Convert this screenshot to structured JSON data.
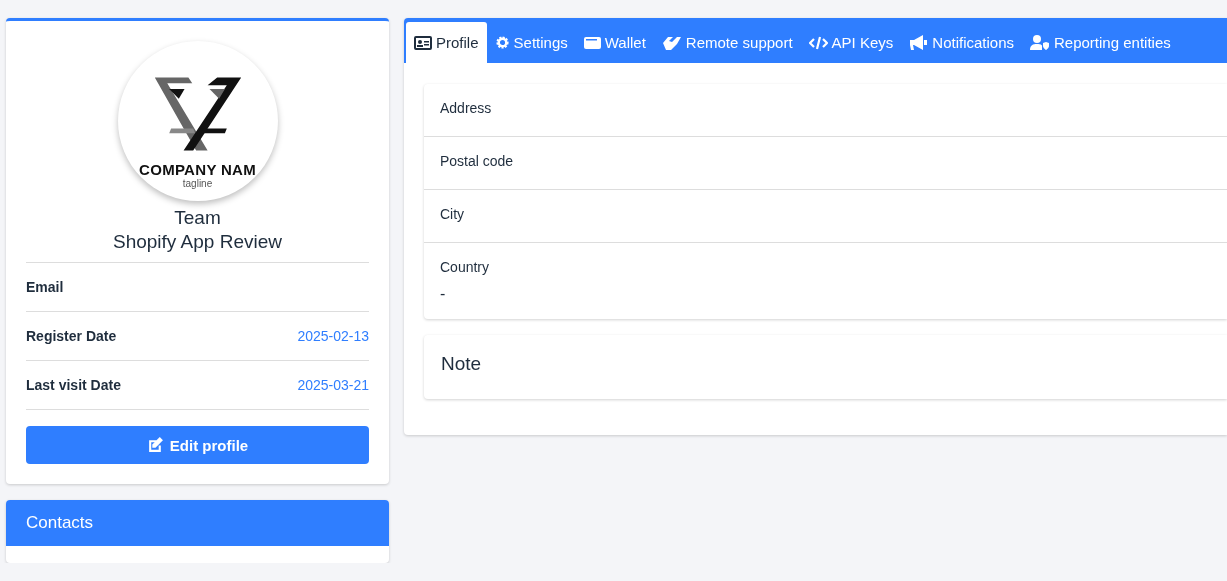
{
  "profile_card": {
    "logo": {
      "name": "COMPANY NAM",
      "tagline": "tagline"
    },
    "team": "Team",
    "name": "Shopify App Review",
    "details": [
      {
        "label": "Email"
      },
      {
        "label": "Register Date",
        "value": "2025-02-13"
      },
      {
        "label": "Last visit Date",
        "value": "2025-03-21"
      }
    ],
    "edit_button": "Edit profile"
  },
  "contacts": {
    "title": "Contacts"
  },
  "tabs": [
    {
      "label": "Profile",
      "kind": "id",
      "selected": true
    },
    {
      "label": "Settings",
      "kind": "gear",
      "selected": false
    },
    {
      "label": "Wallet",
      "kind": "wallet",
      "selected": false
    },
    {
      "label": "Remote support",
      "kind": "hands",
      "selected": false
    },
    {
      "label": "API Keys",
      "kind": "code",
      "selected": false
    },
    {
      "label": "Notifications",
      "kind": "megaphone",
      "selected": false
    },
    {
      "label": "Reporting entities",
      "kind": "user",
      "selected": false
    }
  ],
  "fields": [
    {
      "label": "Address"
    },
    {
      "label": "Postal code"
    },
    {
      "label": "City"
    },
    {
      "label": "Country",
      "value": "-"
    }
  ],
  "note": {
    "title": "Note"
  }
}
